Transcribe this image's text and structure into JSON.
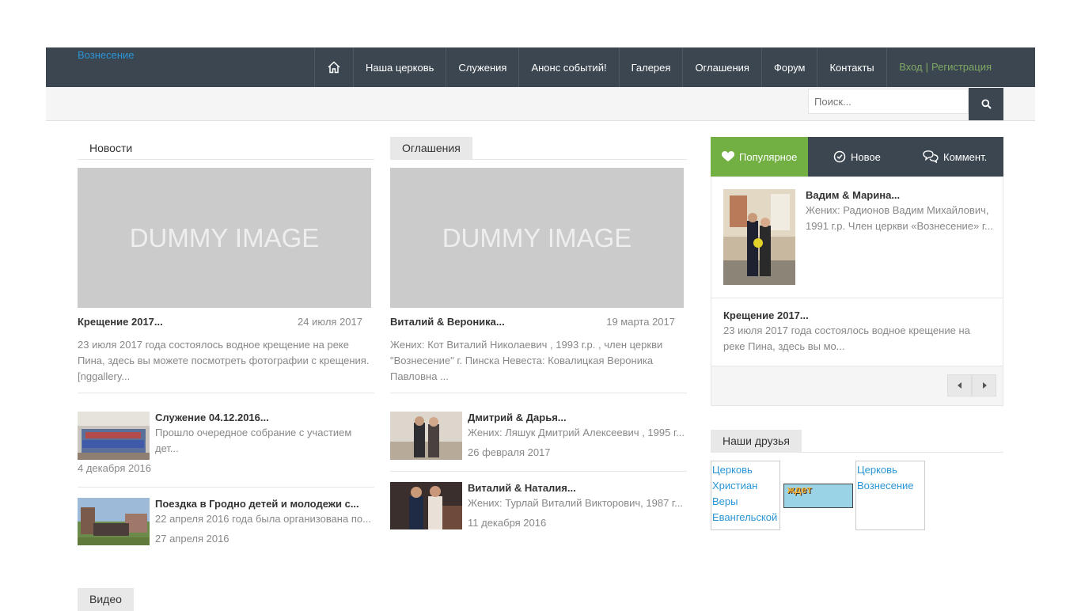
{
  "header": {
    "logo_alt": "Вознесение",
    "nav": [
      "Наша церковь",
      "Служения",
      "Анонс событий!",
      "Галерея",
      "Оглашения",
      "Форум",
      "Контакты"
    ],
    "login": "Вход",
    "register": "Регистрация",
    "search_placeholder": "Поиск..."
  },
  "news": {
    "title": "Новости",
    "image_text": "DUMMY IMAGE",
    "main": {
      "title": "Крещение 2017...",
      "date": "24 июля 2017",
      "text": "23 июля 2017 года состоялось водное крещение на реке Пина, здесь вы можете посмотреть фотографии с крещения. [nggallery..."
    },
    "items": [
      {
        "title": "Служение 04.12.2016...",
        "text": "Прошло очередное собрание с участием дет...",
        "date": "4 декабря 2016"
      },
      {
        "title": "Поездка в Гродно детей и молодежи с...",
        "text": "22 апреля 2016 года была организована по...",
        "date": "27 апреля 2016"
      }
    ]
  },
  "announcements": {
    "title": "Оглашения",
    "image_text": "DUMMY IMAGE",
    "main": {
      "title": "Виталий & Вероника...",
      "date": "19 марта 2017",
      "text": "Жених: Кот Виталий Николаевич , 1993 г.р. , член церкви \"Вознесение\" г. Пинска Невеста: Ковалицкая Вероника Павловна ..."
    },
    "items": [
      {
        "title": "Дмитрий & Дарья...",
        "text": "Жених: Ляшук Дмитрий Алексеевич , 1995 г...",
        "date": "26 февраля 2017"
      },
      {
        "title": "Виталий & Наталия...",
        "text": "Жених: Турлай Виталий Викторович, 1987 г...",
        "date": "11 декабря 2016"
      }
    ]
  },
  "sidebar": {
    "tabs": [
      "Популярное",
      "Новое",
      "Коммент."
    ],
    "posts": [
      {
        "title": "Вадим & Марина...",
        "text": "Жених: Радионов Вадим Михайлович, 1991 г.р. Член церкви «Вознесение» г..."
      },
      {
        "title": "Крещение 2017...",
        "text": "23 июля 2017 года состоялось водное крещение на реке Пина, здесь вы мо..."
      }
    ],
    "friends_title": "Наши друзья",
    "friends": [
      "Церковь Христиан Веры Евангельской",
      "ждет",
      "Церковь Вознесение"
    ]
  },
  "video": {
    "title": "Видео"
  },
  "colors": {
    "nav_bg": "#3b4650",
    "accent_green": "#72b043",
    "link_blue": "#2a95d6"
  }
}
